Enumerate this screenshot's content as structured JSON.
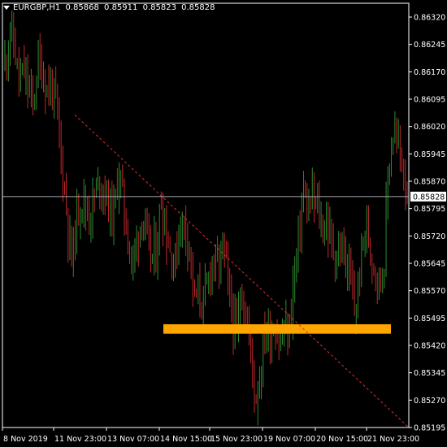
{
  "header": {
    "symbol_timeframe": "EURGBP,H1",
    "open": "0.85868",
    "high": "0.85911",
    "low": "0.85823",
    "close": "0.85828"
  },
  "colors": {
    "background": "#000000",
    "axis": "#ffffff",
    "bull_candle": "#2e8b2e",
    "bear_candle": "#c0282a",
    "trendline": "#e03030",
    "zone": "#ffa500",
    "price_line": "#a9a9b6"
  },
  "current_price": {
    "label": "0.85828",
    "value": 0.85828
  },
  "chart_data": {
    "type": "candlestick",
    "y_ticks": [
      "0.86320",
      "0.86245",
      "0.86170",
      "0.86095",
      "0.86020",
      "0.85945",
      "0.85870",
      "0.85795",
      "0.85720",
      "0.85645",
      "0.85570",
      "0.85495",
      "0.85420",
      "0.85345",
      "0.85270",
      "0.85195"
    ],
    "x_ticks": [
      "8 Nov 2019",
      "11 Nov 23:00",
      "13 Nov 07:00",
      "14 Nov 15:00",
      "15 Nov 23:00",
      "19 Nov 07:00",
      "20 Nov 15:00",
      "21 Nov 23:00"
    ],
    "ylim": [
      0.85195,
      0.8632
    ],
    "trendline": {
      "from": 0.86052,
      "to": 0.85195
    },
    "zone": {
      "low": 0.85452,
      "high": 0.85478
    },
    "price_path": [
      0.8619,
      0.8629,
      0.8624,
      0.8614,
      0.8617,
      0.8612,
      0.8608,
      0.862,
      0.8617,
      0.8612,
      0.8613,
      0.8606,
      0.8592,
      0.858,
      0.8565,
      0.8575,
      0.8583,
      0.858,
      0.8578,
      0.8583,
      0.8587,
      0.8585,
      0.858,
      0.8578,
      0.859,
      0.8582,
      0.8571,
      0.8564,
      0.8572,
      0.8578,
      0.857,
      0.8566,
      0.8568,
      0.8582,
      0.8574,
      0.8567,
      0.8565,
      0.8576,
      0.8575,
      0.857,
      0.8554,
      0.8556,
      0.8553,
      0.856,
      0.8567,
      0.8562,
      0.857,
      0.856,
      0.855,
      0.8545,
      0.8558,
      0.855,
      0.854,
      0.8527,
      0.8535,
      0.8547,
      0.8545,
      0.8548,
      0.8542,
      0.8546,
      0.8545,
      0.856,
      0.857,
      0.8585,
      0.8578,
      0.8582,
      0.858,
      0.8574,
      0.8576,
      0.857,
      0.8566,
      0.8568,
      0.8565,
      0.856,
      0.855,
      0.8562,
      0.8575,
      0.857,
      0.8565,
      0.856,
      0.8562,
      0.859,
      0.86,
      0.8598,
      0.8592,
      0.8585
    ]
  }
}
